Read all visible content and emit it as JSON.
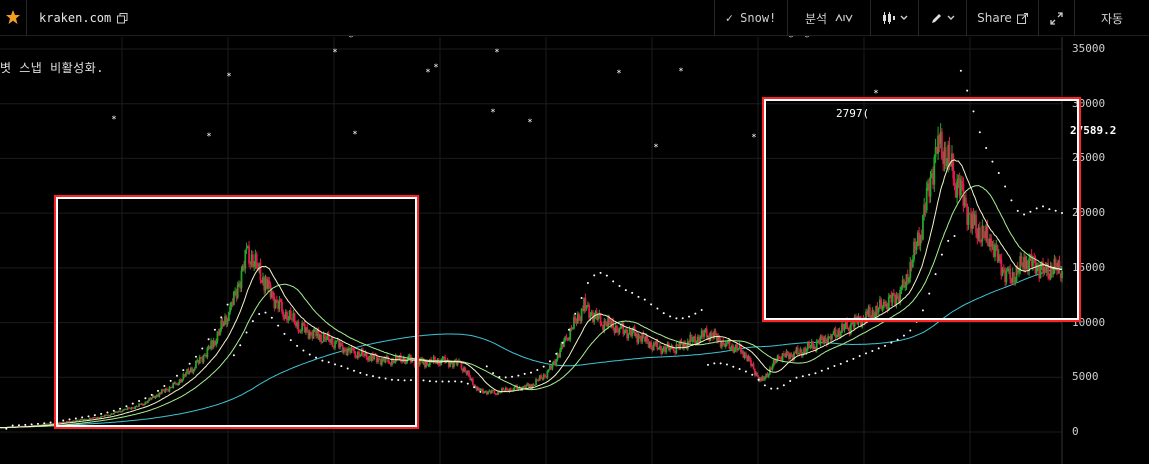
{
  "toolbar": {
    "site": "kraken.com",
    "snow_label": "✓ Snow!",
    "analysis_label": "분석",
    "share_label": "Share",
    "auto_label": "자동",
    "favorite_icon": "star-icon",
    "copy_icon": "copy-icon",
    "chart_type_icon": "candles-icon",
    "drawing_icon": "pencil-icon",
    "share_icon": "external-link-icon",
    "fullscreen_icon": "expand-icon"
  },
  "chart": {
    "note": "볏 스냅 비활성화.",
    "current_price": "27589.2",
    "peak_label": "2797(",
    "y_axis_labels": [
      "35000",
      "30000",
      "25000",
      "20000",
      "15000",
      "10000",
      "5000",
      "0"
    ],
    "colors": {
      "up": "#26a32b",
      "down": "#e8174f",
      "ma_fast": "#f5f5c8",
      "ma_mid": "#a8f090",
      "ma_slow": "#3fc6d6",
      "dots": "#ffffff",
      "highlight": "#ff2222",
      "grid": "#1c1c1c"
    }
  },
  "chart_data": {
    "type": "line",
    "y_axis_labels": [
      "35000",
      "30000",
      "25000",
      "20000",
      "15000",
      "10000",
      "5000",
      "0"
    ],
    "ylim": [
      0,
      35000
    ],
    "x": [
      0,
      1,
      2,
      3,
      4,
      5,
      6,
      7,
      8,
      9,
      10,
      11,
      12,
      13,
      14,
      15,
      16,
      17,
      18,
      19,
      20,
      21,
      22,
      23,
      24,
      25,
      26,
      27,
      28,
      29,
      30,
      31,
      32,
      33,
      34,
      35,
      36,
      37,
      38,
      39,
      40,
      41,
      42,
      43,
      44,
      45,
      46,
      47,
      48,
      49,
      50,
      51,
      52,
      53,
      54,
      55,
      56,
      57,
      58,
      59,
      60
    ],
    "series": [
      {
        "values": [
          400,
          500,
          600,
          800,
          1000,
          1200,
          1500,
          2000,
          2500,
          3500,
          4500,
          6000,
          8000,
          11000,
          16500,
          13500,
          11000,
          9500,
          8800,
          8000,
          7200,
          6800,
          6500,
          6700,
          6300,
          6500,
          6200,
          3800,
          3600,
          4000,
          4200,
          5500,
          8500,
          11500,
          10000,
          9500,
          8800,
          7800,
          7500,
          8300,
          9000,
          8100,
          7300,
          4600,
          6800,
          7200,
          7900,
          8900,
          9700,
          10700,
          11500,
          13000,
          18000,
          27000,
          23000,
          19000,
          17000,
          14000,
          15500,
          15000,
          14700
        ]
      }
    ]
  }
}
